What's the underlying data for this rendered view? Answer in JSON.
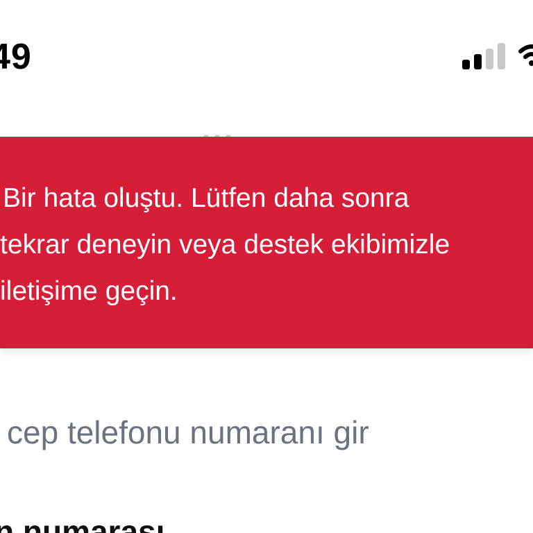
{
  "status_bar": {
    "time": "49",
    "signal_icon": "cellular-signal-icon",
    "wifi_icon": "wifi-icon"
  },
  "error": {
    "lines": [
      "Bir hata oluştu. Lütfen daha sonra",
      "tekrar deneyin veya destek ekibimizle",
      "iletişime geçin."
    ],
    "background_color": "#d71e38",
    "text_color": "#ffffff"
  },
  "form": {
    "prompt": "cep telefonu numaranı gir",
    "field_label": "n numarası"
  },
  "colors": {
    "prompt_text": "#6b7280",
    "label_text": "#111111"
  }
}
